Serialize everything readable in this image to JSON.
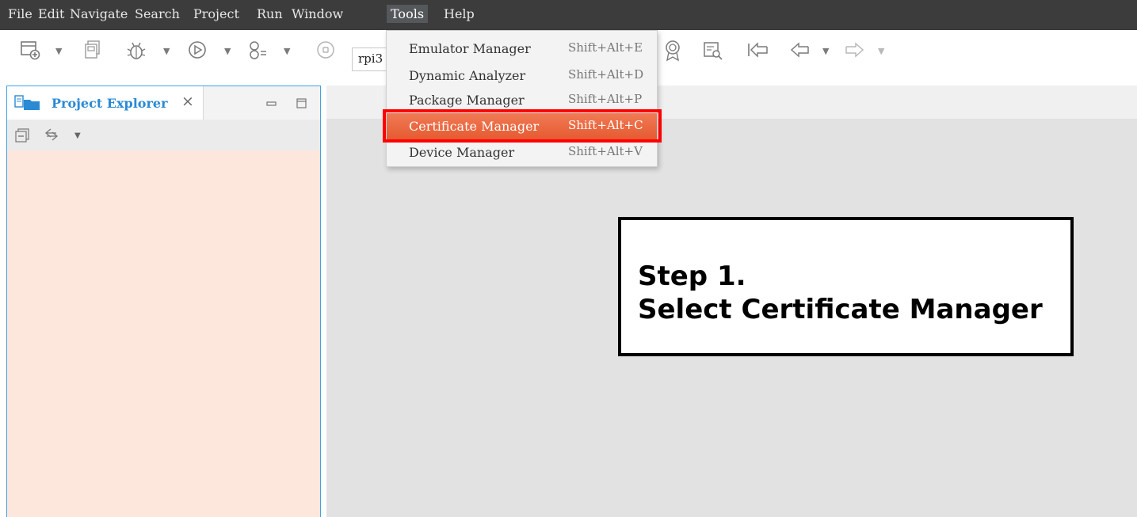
{
  "menubar": {
    "items": [
      "File",
      "Edit",
      "Navigate",
      "Search",
      "Project",
      "Run",
      "Window",
      "Tools",
      "Help"
    ],
    "active": "Tools"
  },
  "toolbar": {
    "target_value": "rpi3",
    "icons": [
      "new-project-icon",
      "dropdown-arrow-icon",
      "save-all-icon",
      "debug-icon",
      "run-icon",
      "run-config-icon",
      "stop-icon",
      "certificate-icon",
      "search-icon",
      "last-edit-icon",
      "back-icon",
      "forward-icon"
    ]
  },
  "tools_menu": {
    "items": [
      {
        "label": "Emulator Manager",
        "shortcut": "Shift+Alt+E"
      },
      {
        "label": "Dynamic Analyzer",
        "shortcut": "Shift+Alt+D"
      },
      {
        "label": "Package Manager",
        "shortcut": "Shift+Alt+P"
      },
      {
        "label": "Certificate Manager",
        "shortcut": "Shift+Alt+C"
      },
      {
        "label": "Device Manager",
        "shortcut": "Shift+Alt+V"
      }
    ],
    "highlighted_index": 3
  },
  "project_explorer": {
    "title": "Project Explorer",
    "close_glyph": "×"
  },
  "callout": {
    "line1": "Step 1.",
    "line2": "Select Certificate Manager"
  },
  "colors": {
    "menubar_bg": "#3c3c3c",
    "panel_bg": "#fde6dc",
    "panel_border": "#3da4e6",
    "highlight": "#e8643c",
    "callout_border": "#ff0000"
  }
}
